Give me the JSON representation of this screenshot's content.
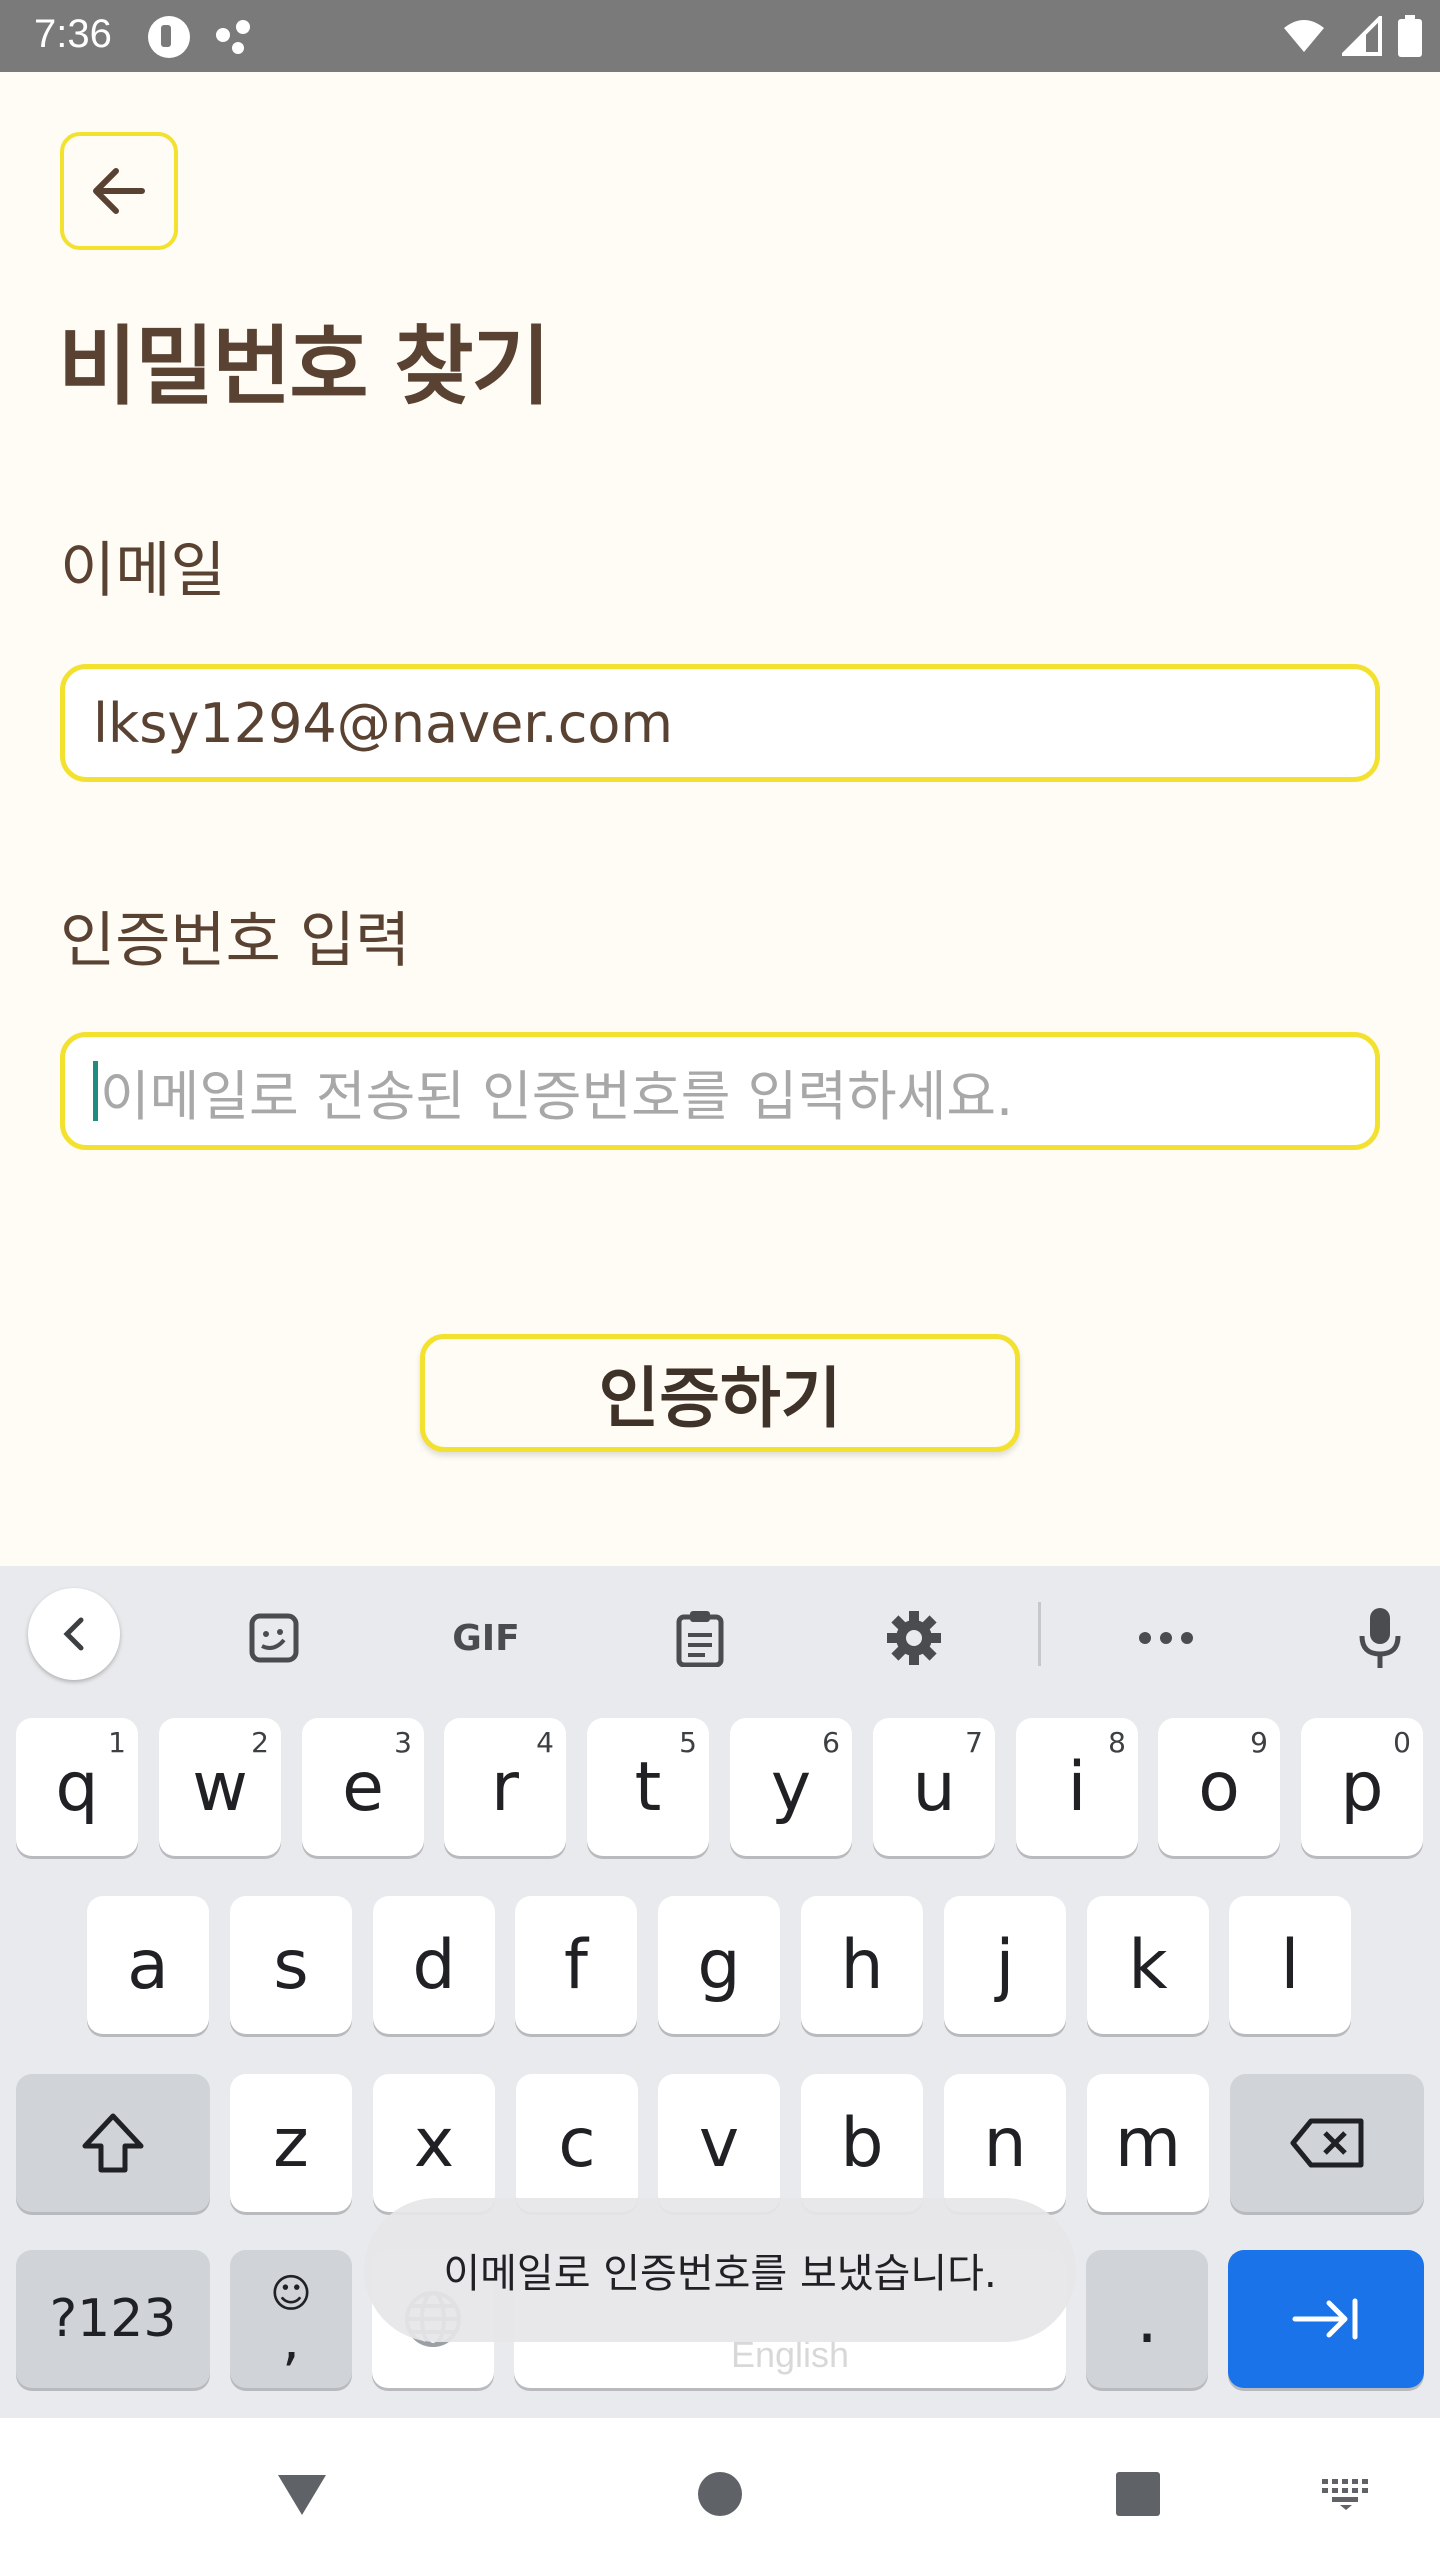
{
  "status_bar": {
    "time": "7:36",
    "icons": [
      "app-notification-icon",
      "assistant-dots-icon",
      "wifi-icon",
      "signal-icon",
      "battery-icon"
    ]
  },
  "header": {
    "back_icon": "arrow-left-icon",
    "title": "비밀번호 찾기"
  },
  "form": {
    "email_label": "이메일",
    "email_value": "lksy1294@naver.com",
    "code_label": "인증번호 입력",
    "code_placeholder": "이메일로 전송된 인증번호를 입력하세요.",
    "verify_button": "인증하기"
  },
  "keyboard": {
    "toolbar_icons": [
      "chevron-left-icon",
      "sticker-icon",
      "gif-icon",
      "clipboard-icon",
      "gear-icon",
      "more-icon",
      "microphone-icon"
    ],
    "gif_label": "GIF",
    "row1": [
      {
        "k": "q",
        "n": "1"
      },
      {
        "k": "w",
        "n": "2"
      },
      {
        "k": "e",
        "n": "3"
      },
      {
        "k": "r",
        "n": "4"
      },
      {
        "k": "t",
        "n": "5"
      },
      {
        "k": "y",
        "n": "6"
      },
      {
        "k": "u",
        "n": "7"
      },
      {
        "k": "i",
        "n": "8"
      },
      {
        "k": "o",
        "n": "9"
      },
      {
        "k": "p",
        "n": "0"
      }
    ],
    "row2": [
      "a",
      "s",
      "d",
      "f",
      "g",
      "h",
      "j",
      "k",
      "l"
    ],
    "row3": [
      "z",
      "x",
      "c",
      "v",
      "b",
      "n",
      "m"
    ],
    "symbols_key": "?123",
    "emoji_glyph": "☺",
    "comma_key": ",",
    "space_label": "English",
    "period_key": "."
  },
  "toast": {
    "message": "이메일로 인증번호를 보냈습니다."
  },
  "colors": {
    "accent_yellow": "#F2E12E",
    "title_brown": "#5A4232",
    "background_cream": "#FFFBF5",
    "enter_blue": "#1A73E8",
    "caret_teal": "#1F8C84"
  }
}
